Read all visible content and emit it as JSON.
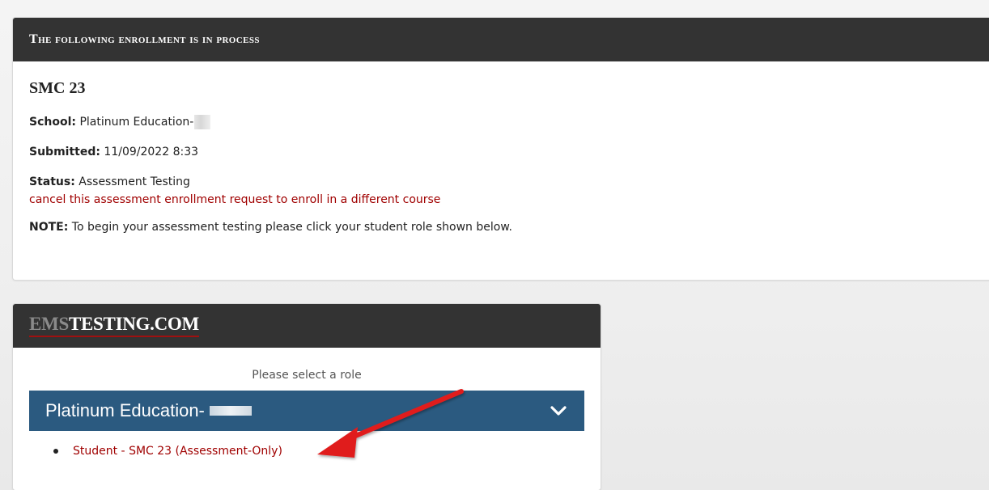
{
  "enrollment": {
    "header": "The following enrollment is in process",
    "course": "SMC 23",
    "school_label": "School:",
    "school_value": "Platinum Education-",
    "submitted_label": "Submitted:",
    "submitted_value": "11/09/2022 8:33",
    "status_label": "Status:",
    "status_value": "Assessment Testing",
    "cancel_link": "cancel this assessment enrollment request to enroll in a different course",
    "note_label": "NOTE:",
    "note_value": "To begin your assessment testing please click your student role shown below."
  },
  "emstesting": {
    "logo_part1": "EMS",
    "logo_part2": "TESTING.COM",
    "prompt": "Please select a role",
    "group_label": "Platinum Education-",
    "roles": [
      {
        "label": "Student - SMC 23 (Assessment-Only)"
      }
    ]
  },
  "colors": {
    "header_bg": "#333333",
    "accent_red": "#a00000",
    "role_group_bg": "#2b5a80",
    "arrow_red": "#e01e1e"
  },
  "icons": {
    "group_toggle": "chevron-down-icon",
    "annotation": "red-arrow-icon"
  }
}
